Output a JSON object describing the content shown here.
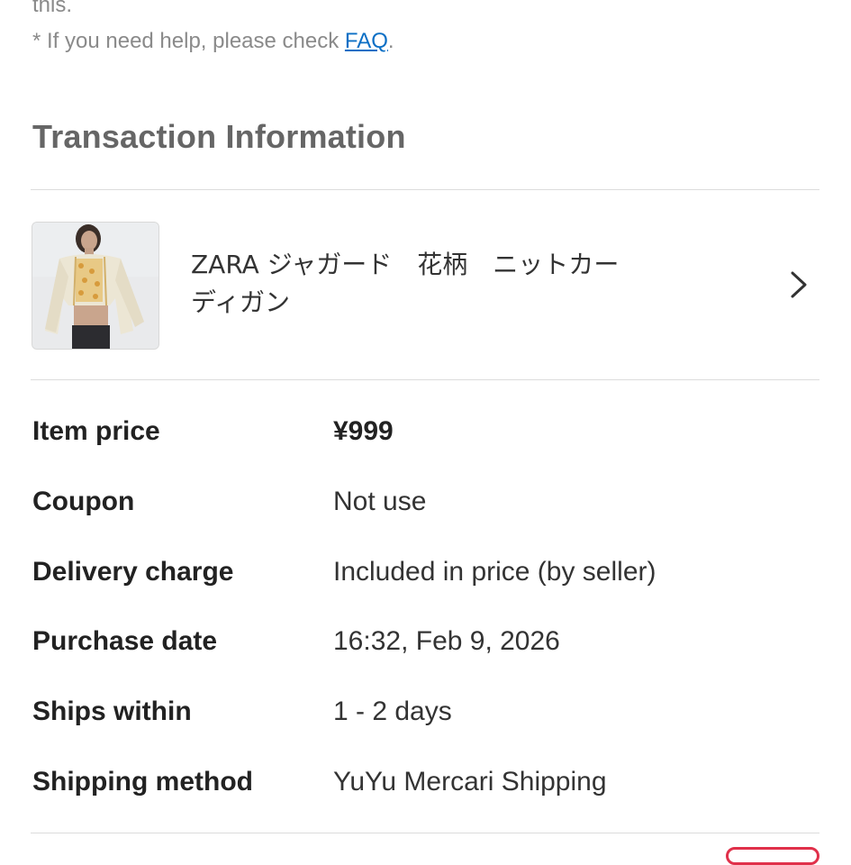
{
  "top_note": {
    "line1": "this.",
    "line2_prefix": "* If you need help, please check ",
    "faq_link": "FAQ",
    "line2_suffix": "."
  },
  "section": {
    "title": "Transaction Information"
  },
  "item": {
    "name_line1": "ZARA ジャガード　花柄　ニットカー",
    "name_line2": "ディガン",
    "thumbnail_icon": "product-photo",
    "chevron_icon": "chevron-right-icon"
  },
  "details": [
    {
      "label": "Item price",
      "value": "¥999"
    },
    {
      "label": "Coupon",
      "value": "Not use"
    },
    {
      "label": "Delivery charge",
      "value": "Included in price (by seller)"
    },
    {
      "label": "Purchase date",
      "value": "16:32, Feb 9, 2026"
    },
    {
      "label": "Ships within",
      "value": "1 - 2 days"
    },
    {
      "label": "Shipping method",
      "value": "YuYu Mercari Shipping"
    }
  ],
  "colors": {
    "link": "#0b6fc5",
    "accent_badge": "#e0304a",
    "section_title": "#666666"
  }
}
